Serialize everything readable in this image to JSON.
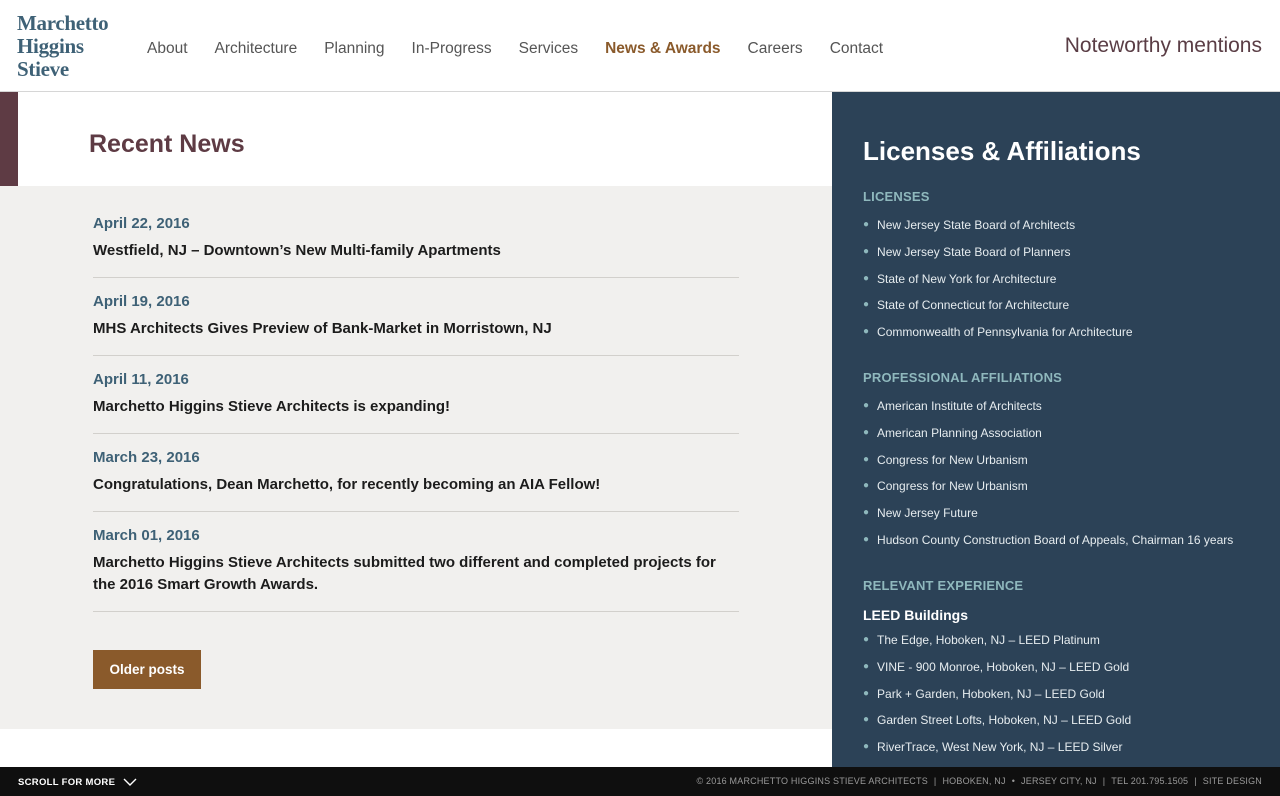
{
  "brand": {
    "line1": "Marchetto",
    "line2": "Higgins",
    "line3": "Stieve"
  },
  "nav": {
    "items": [
      {
        "label": "About",
        "active": false
      },
      {
        "label": "Architecture",
        "active": false
      },
      {
        "label": "Planning",
        "active": false
      },
      {
        "label": "In-Progress",
        "active": false
      },
      {
        "label": "Services",
        "active": false
      },
      {
        "label": "News & Awards",
        "active": true
      },
      {
        "label": "Careers",
        "active": false
      },
      {
        "label": "Contact",
        "active": false
      }
    ]
  },
  "tagline": "Noteworthy mentions",
  "main": {
    "title": "Recent News",
    "news": [
      {
        "date": "April 22, 2016",
        "headline": "Westfield, NJ – Downtown’s New Multi-family Apartments"
      },
      {
        "date": "April 19, 2016",
        "headline": "MHS Architects Gives Preview of Bank-Market in Morristown, NJ"
      },
      {
        "date": "April 11, 2016",
        "headline": "Marchetto Higgins Stieve Architects is expanding!"
      },
      {
        "date": "March 23, 2016",
        "headline": "Congratulations, Dean Marchetto, for recently becoming an AIA Fellow!"
      },
      {
        "date": "March 01, 2016",
        "headline": "Marchetto Higgins Stieve Architects submitted two different and completed projects for the 2016 Smart Growth Awards."
      }
    ],
    "older_label": "Older posts"
  },
  "sidebar": {
    "title": "Licenses & Affiliations",
    "licenses": {
      "heading": "LICENSES",
      "items": [
        "New Jersey State Board of Architects",
        "New Jersey State Board of Planners",
        "State of New York for Architecture",
        "State of Connecticut for Architecture",
        "Commonwealth of Pennsylvania for Architecture"
      ]
    },
    "affiliations": {
      "heading": "PROFESSIONAL AFFILIATIONS",
      "items": [
        "American Institute of Architects",
        "American Planning Association",
        "Congress for New Urbanism",
        "Congress for New Urbanism",
        "New Jersey Future",
        "Hudson County Construction Board of Appeals, Chairman 16 years"
      ]
    },
    "experience": {
      "heading": "RELEVANT EXPERIENCE",
      "subheading": "LEED Buildings",
      "items": [
        "The Edge, Hoboken, NJ – LEED Platinum",
        "VINE - 900 Monroe, Hoboken, NJ – LEED Gold",
        "Park + Garden, Hoboken, NJ – LEED Gold",
        "Garden Street Lofts, Hoboken, NJ – LEED Gold",
        "RiverTrace, West New York, NJ – LEED Silver"
      ]
    }
  },
  "footer": {
    "scroll_label": "SCROLL FOR MORE",
    "copyright": "© 2016 MARCHETTO HIGGINS STIEVE ARCHITECTS",
    "loc1": "HOBOKEN, NJ",
    "loc2": "JERSEY CITY, NJ",
    "tel": "TEL 201.795.1505",
    "site_design": "SITE DESIGN"
  },
  "colors": {
    "brand_blue": "#3e6176",
    "accent_brown": "#8a5a2b",
    "title_maroon": "#5e3b44",
    "sidebar_navy": "#2c4257",
    "sidebar_teal": "#8fb8bd"
  }
}
